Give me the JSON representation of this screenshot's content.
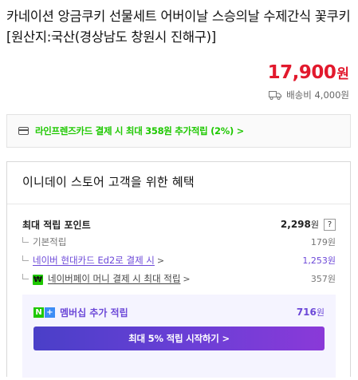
{
  "product": {
    "title": "카네이션 앙금쿠키 선물세트 어버이날 스승의날 수제간식 꽃쿠키 [원산지:국산(경상남도 창원시 진해구)]",
    "price": "17,900",
    "currency": "원",
    "shipping": "배송비 4,000원"
  },
  "card_banner": {
    "icon": "credit-card-icon",
    "text": "라인프렌즈카드 결제 시 최대 358원 추가적립 (2%) >"
  },
  "benefit": {
    "title": "이니데이 스토어 고객을 위한 혜택",
    "max_points_label": "최대 적립 포인트",
    "max_points_value": "2,298",
    "max_points_unit": "원",
    "help_label": "?",
    "basic_label": "기본적립",
    "basic_value": "179원",
    "card_label": "네이버 현대카드 Ed2로 결제 시",
    "card_value": "1,253원",
    "npay_label": "네이버페이 머니 결제 시 최대 적립",
    "npay_value": "357원",
    "chevron": ">",
    "membership": {
      "n_badge": "N",
      "plus_badge": "+",
      "label": "멤버십 추가 적립",
      "value": "716",
      "unit": "원",
      "cta": "최대 5% 적립 시작하기 >"
    }
  },
  "colors": {
    "price_red": "#e2192d",
    "naver_green": "#1ec800",
    "purple": "#6c48d8",
    "member_bg": "#f5f4ff"
  }
}
